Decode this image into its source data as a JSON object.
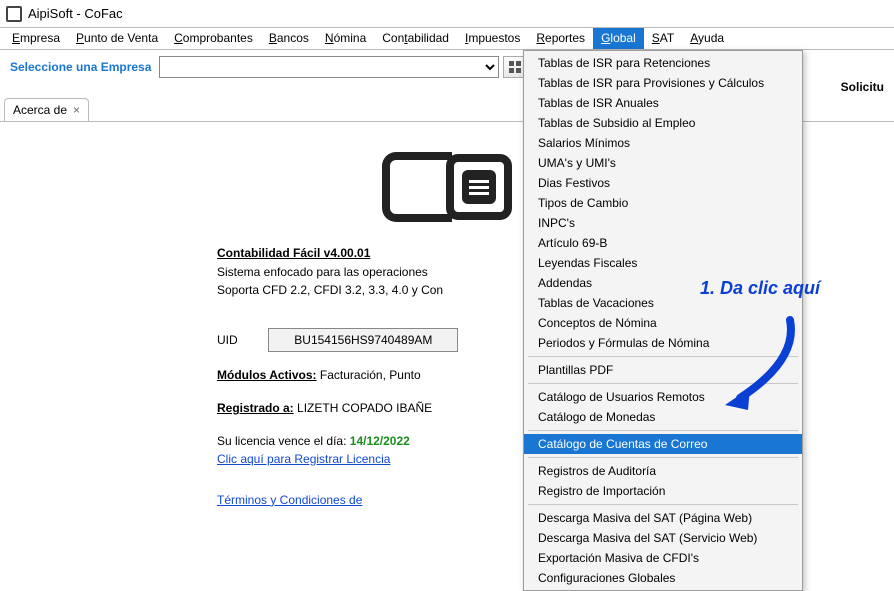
{
  "window": {
    "title": "AipiSoft - CoFac"
  },
  "menubar": {
    "empresa": "Empresa",
    "punto_venta": "Punto de Venta",
    "comprobantes": "Comprobantes",
    "bancos": "Bancos",
    "nomina": "Nómina",
    "contabilidad": "Contabilidad",
    "impuestos": "Impuestos",
    "reportes": "Reportes",
    "global": "Global",
    "sat": "SAT",
    "ayuda": "Ayuda"
  },
  "toolbar": {
    "select_label": "Seleccione una Empresa",
    "solicitud": "Solicitu"
  },
  "tab": {
    "label": "Acerca de",
    "close": "×"
  },
  "about": {
    "heading": "Contabilidad Fácil v4.00.01",
    "line1": "Sistema enfocado para las operaciones",
    "line2": "Soporta CFD 2.2, CFDI 3.2, 3.3, 4.0 y Con",
    "uid_label": "UID",
    "uid_value": "BU154156HS9740489AM",
    "modulos_label": "Módulos Activos:",
    "modulos_value": "Facturación, Punto",
    "registrado_label": "Registrado a:",
    "registrado_value": "LIZETH COPADO IBAÑE",
    "licencia_prefix": "Su licencia vence el día:",
    "licencia_date": "14/12/2022",
    "licencia_link": "Clic aquí para Registrar Licencia",
    "terminos": "Términos y Condiciones de"
  },
  "dropdown": {
    "items": [
      "Tablas de ISR para Retenciones",
      "Tablas de ISR para Provisiones y Cálculos",
      "Tablas de ISR Anuales",
      "Tablas de Subsidio al Empleo",
      "Salarios Mínimos",
      "UMA's y UMI's",
      "Dias Festivos",
      "Tipos de Cambio",
      "INPC's",
      "Artículo 69-B",
      "Leyendas Fiscales",
      "Addendas",
      "Tablas de Vacaciones",
      "Conceptos de Nómina",
      "Periodos y Fórmulas de Nómina",
      "Plantillas PDF",
      "Catálogo de Usuarios Remotos",
      "Catálogo de Monedas",
      "Catálogo de Cuentas de Correo",
      "Registros de Auditoría",
      "Registro de Importación",
      "Descarga Masiva del SAT (Página Web)",
      "Descarga Masiva del SAT (Servicio Web)",
      "Exportación Masiva de CFDI's",
      "Configuraciones Globales"
    ],
    "selected_index": 18,
    "separators_after": [
      14,
      15,
      17,
      18,
      20
    ]
  },
  "callout": {
    "text": "1. Da clic aquí"
  }
}
